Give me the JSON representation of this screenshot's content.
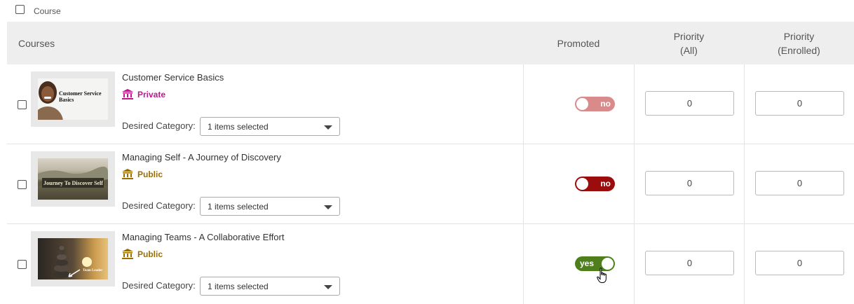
{
  "header_filter": {
    "label": "Course"
  },
  "table": {
    "headers": {
      "courses": "Courses",
      "promoted": "Promoted",
      "priority_all_line1": "Priority",
      "priority_all_line2": "(All)",
      "priority_enrolled_line1": "Priority",
      "priority_enrolled_line2": "(Enrolled)"
    },
    "rows": [
      {
        "title": "Customer Service Basics",
        "visibility": "Private",
        "visibility_color": "#c0188c",
        "thumb_text": "Customer Service Basics",
        "category_label": "Desired Category:",
        "category_value": "1 items selected",
        "promoted": "no",
        "promoted_color": "#d98a8a",
        "priority_all": "0",
        "priority_enrolled": "0"
      },
      {
        "title": "Managing Self - A Journey of Discovery",
        "visibility": "Public",
        "visibility_color": "#9a6e00",
        "thumb_text": "Journey To Discover Self",
        "category_label": "Desired Category:",
        "category_value": "1 items selected",
        "promoted": "no",
        "promoted_color": "#9b0d0d",
        "priority_all": "0",
        "priority_enrolled": "0"
      },
      {
        "title": "Managing Teams - A Collaborative Effort",
        "visibility": "Public",
        "visibility_color": "#9a6e00",
        "thumb_text": "Team Leader",
        "category_label": "Desired Category:",
        "category_value": "1 items selected",
        "promoted": "yes",
        "promoted_color": "#4e7f1c",
        "priority_all": "0",
        "priority_enrolled": "0"
      }
    ]
  }
}
